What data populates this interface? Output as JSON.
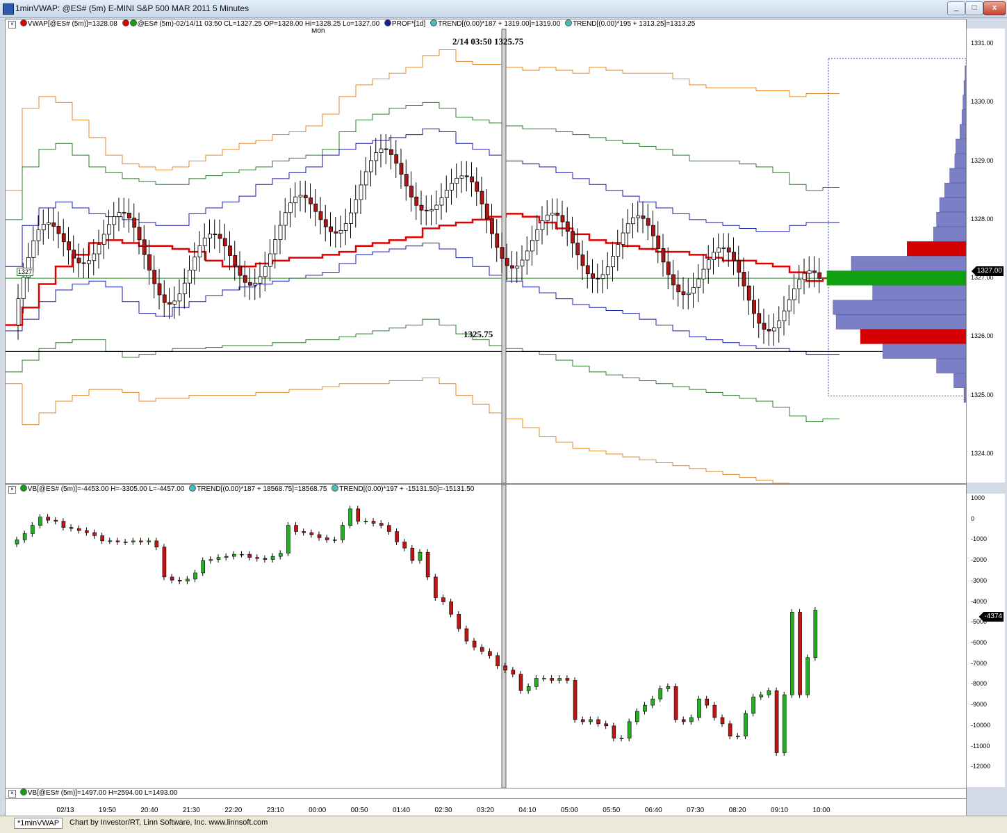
{
  "window": {
    "title": "1minVWAP: @ES# (5m) E-MINI S&P 500 MAR 2011 5 Minutes",
    "minimize": "_",
    "maximize": "□",
    "close": "x"
  },
  "price_pane": {
    "legend": {
      "close_x": "×",
      "vwap": "VWAP[@ES# (5m)]=1328.08",
      "bars": "@ES# (5m)-02/14/11 03:50 CL=1327.25 OP=1328.00 Hi=1328.25 Lo=1327.00",
      "prof": "PROF*[1d]",
      "trend1": "TREND[(0.00)*187 + 1319.00]=1319.00",
      "trend2": "TREND[(0.00)*195 + 1313.25]=1313.25"
    },
    "day_label": "Mon",
    "crosshair_label": "2/14 03:50  1325.75",
    "hline_label": "1325.75",
    "small_tag": "1327",
    "last_price_tag": "1327.00",
    "colors": {
      "vwap": "#e00000",
      "band1": "#1a1aa8",
      "band2": "#2d7a2d",
      "band3": "#e0892a",
      "up": "#ffffff",
      "down": "#b01515",
      "profile": "#7b7fc6",
      "poc": "#10a010",
      "value_edge": "#d40000"
    }
  },
  "vb_pane": {
    "legend": {
      "close_x": "×",
      "vb": "VB[@ES# (5m)]=-4453.00 H=-3305.00 L=-4457.00",
      "trend1": "TREND[(0.00)*187 + 18568.75]=18568.75",
      "trend2": "TREND[(0.00)*197 + -15131.50]=-15131.50"
    },
    "last_value_tag": "-4374"
  },
  "volume_pane": {
    "legend": {
      "close_x": "×",
      "vb": "VB[@ES# (5m)]=1497.00 H=2594.00 L=1493.00"
    }
  },
  "tabs": {
    "active": "*1minVWAP",
    "credit": "Chart by Investor/RT, Linn Software, Inc. www.linnsoft.com"
  },
  "chart_data": [
    {
      "type": "candlestick",
      "title": "1minVWAP: @ES# (5m) E-MINI S&P 500 MAR 2011 5 Minutes",
      "ylim": [
        1323.5,
        1331.25
      ],
      "y_ticks": [
        "1331.00",
        "1330.00",
        "1329.00",
        "1328.00",
        "1327.00",
        "1326.00",
        "1325.00",
        "1324.00"
      ],
      "x_ticks": [
        "02/13",
        "19:50",
        "20:40",
        "21:30",
        "22:20",
        "23:10",
        "00:00",
        "00:50",
        "01:40",
        "02:30",
        "03:20",
        "04:10",
        "05:00",
        "05:50",
        "06:40",
        "07:30",
        "08:20",
        "09:10",
        "10:00"
      ],
      "vwap": [
        1326.2,
        1326.5,
        1326.9,
        1327.2,
        1327.4,
        1327.6,
        1327.65,
        1327.6,
        1327.55,
        1327.55,
        1327.5,
        1327.45,
        1327.3,
        1327.2,
        1327.2,
        1327.25,
        1327.3,
        1327.35,
        1327.35,
        1327.4,
        1327.45,
        1327.55,
        1327.6,
        1327.65,
        1327.7,
        1327.85,
        1327.9,
        1327.95,
        1328.0,
        1328.05,
        1328.1,
        1328.05,
        1327.95,
        1327.85,
        1327.75,
        1327.65,
        1327.6,
        1327.55,
        1327.5,
        1327.45,
        1327.45,
        1327.4,
        1327.35,
        1327.3,
        1327.3,
        1327.25,
        1327.2,
        1327.1,
        1326.95,
        1327.0
      ],
      "band1_upper": [
        1327.2,
        1327.9,
        1328.2,
        1328.3,
        1328.2,
        1328.1,
        1328.05,
        1328.0,
        1327.95,
        1327.9,
        1327.9,
        1328.1,
        1328.2,
        1328.3,
        1328.4,
        1328.6,
        1328.7,
        1328.8,
        1328.9,
        1329.1,
        1329.2,
        1329.3,
        1329.35,
        1329.4,
        1329.45,
        1329.55,
        1329.5,
        1329.3,
        1329.2,
        1329.1,
        1329.0,
        1328.95,
        1328.9,
        1328.8,
        1328.7,
        1328.6,
        1328.5,
        1328.4,
        1328.3,
        1328.2,
        1328.1,
        1328.0,
        1327.95,
        1327.9,
        1327.85,
        1327.8,
        1327.8,
        1327.9,
        1327.95,
        1327.95
      ],
      "band1_lower": [
        1326.1,
        1326.3,
        1326.6,
        1326.8,
        1326.9,
        1326.95,
        1326.85,
        1326.6,
        1326.4,
        1326.35,
        1326.5,
        1326.6,
        1326.7,
        1326.8,
        1326.85,
        1326.9,
        1326.95,
        1327.0,
        1327.05,
        1327.1,
        1327.25,
        1327.4,
        1327.45,
        1327.5,
        1327.55,
        1327.6,
        1327.5,
        1327.35,
        1327.2,
        1327.05,
        1326.95,
        1326.85,
        1326.75,
        1326.65,
        1326.55,
        1326.5,
        1326.45,
        1326.4,
        1326.3,
        1326.2,
        1326.1,
        1326.0,
        1325.95,
        1325.9,
        1325.85,
        1325.8,
        1325.8,
        1325.75,
        1325.7,
        1325.7
      ],
      "band2_upper": [
        1328.0,
        1328.9,
        1329.2,
        1329.3,
        1329.1,
        1328.9,
        1328.8,
        1328.7,
        1328.65,
        1328.6,
        1328.6,
        1328.7,
        1328.75,
        1328.8,
        1328.85,
        1328.9,
        1329.0,
        1329.05,
        1329.1,
        1329.2,
        1329.5,
        1329.7,
        1329.8,
        1329.9,
        1329.95,
        1330.0,
        1329.9,
        1329.75,
        1329.7,
        1329.65,
        1329.6,
        1329.55,
        1329.55,
        1329.5,
        1329.45,
        1329.4,
        1329.35,
        1329.3,
        1329.25,
        1329.2,
        1329.1,
        1329.0,
        1329.0,
        1329.0,
        1328.95,
        1328.9,
        1328.8,
        1328.6,
        1328.5,
        1328.55
      ],
      "band2_lower": [
        1325.4,
        1325.6,
        1325.8,
        1325.9,
        1325.95,
        1325.95,
        1325.75,
        1325.65,
        1325.7,
        1325.75,
        1325.8,
        1325.8,
        1325.82,
        1325.85,
        1325.85,
        1325.85,
        1325.9,
        1325.9,
        1325.95,
        1325.95,
        1326.0,
        1326.05,
        1326.1,
        1326.15,
        1326.2,
        1326.3,
        1326.2,
        1326.05,
        1325.95,
        1325.85,
        1325.8,
        1325.75,
        1325.7,
        1325.6,
        1325.5,
        1325.4,
        1325.35,
        1325.3,
        1325.25,
        1325.2,
        1325.15,
        1325.1,
        1325.05,
        1325.0,
        1324.95,
        1324.9,
        1324.8,
        1324.65,
        1324.55,
        1324.6
      ],
      "band3_upper": [
        1328.5,
        1329.9,
        1330.1,
        1330.0,
        1329.7,
        1329.4,
        1329.1,
        1328.95,
        1328.9,
        1328.85,
        1328.9,
        1329.0,
        1329.1,
        1329.2,
        1329.3,
        1329.35,
        1329.45,
        1329.5,
        1329.6,
        1329.8,
        1330.1,
        1330.3,
        1330.4,
        1330.5,
        1330.6,
        1330.8,
        1330.9,
        1330.7,
        1330.65,
        1330.65,
        1330.6,
        1330.55,
        1330.6,
        1330.55,
        1330.5,
        1330.6,
        1330.55,
        1330.5,
        1330.5,
        1330.5,
        1330.4,
        1330.3,
        1330.25,
        1330.25,
        1330.25,
        1330.2,
        1330.2,
        1330.1,
        1330.15,
        1330.15
      ],
      "band3_lower": [
        1325.2,
        1324.5,
        1324.7,
        1324.9,
        1325.0,
        1325.1,
        1325.1,
        1325.05,
        1324.9,
        1324.95,
        1324.95,
        1325.0,
        1325.0,
        1325.0,
        1325.0,
        1325.05,
        1325.05,
        1325.1,
        1325.1,
        1325.15,
        1325.2,
        1325.2,
        1325.2,
        1325.25,
        1325.25,
        1325.3,
        1325.2,
        1325.0,
        1324.85,
        1324.7,
        1324.6,
        1324.45,
        1324.3,
        1324.2,
        1324.1,
        1324.05,
        1324.0,
        1323.95,
        1323.9,
        1323.85,
        1323.8,
        1323.75,
        1323.7,
        1323.65,
        1323.6,
        1323.55,
        1323.5,
        1323.4,
        1323.35,
        1323.4
      ],
      "profile": [
        {
          "price": 1330.5,
          "volume": 1
        },
        {
          "price": 1330.25,
          "volume": 2
        },
        {
          "price": 1330.0,
          "volume": 3
        },
        {
          "price": 1329.75,
          "volume": 4
        },
        {
          "price": 1329.5,
          "volume": 6
        },
        {
          "price": 1329.25,
          "volume": 10
        },
        {
          "price": 1329.0,
          "volume": 11
        },
        {
          "price": 1328.75,
          "volume": 16
        },
        {
          "price": 1328.5,
          "volume": 21
        },
        {
          "price": 1328.25,
          "volume": 26
        },
        {
          "price": 1328.0,
          "volume": 29
        },
        {
          "price": 1327.75,
          "volume": 32
        },
        {
          "price": 1327.5,
          "volume": 58
        },
        {
          "price": 1327.25,
          "volume": 113
        },
        {
          "price": 1327.0,
          "volume": 137
        },
        {
          "price": 1326.75,
          "volume": 92
        },
        {
          "price": 1326.5,
          "volume": 131
        },
        {
          "price": 1326.25,
          "volume": 128
        },
        {
          "price": 1326.0,
          "volume": 104
        },
        {
          "price": 1325.75,
          "volume": 82
        },
        {
          "price": 1325.5,
          "volume": 29
        },
        {
          "price": 1325.25,
          "volume": 12
        },
        {
          "price": 1325.0,
          "volume": 2
        }
      ],
      "poc": 1327.0,
      "value_area_high": 1327.5,
      "value_area_low": 1326.0
    },
    {
      "type": "candlestick",
      "title": "VB[@ES# (5m)]",
      "ylim": [
        -13000,
        1200
      ],
      "y_ticks": [
        "1000",
        "0",
        "-1000",
        "-2000",
        "-3000",
        "-4000",
        "-5000",
        "-6000",
        "-7000",
        "-8000",
        "-9000",
        "-10000",
        "-11000",
        "-12000"
      ],
      "close": [
        -1000,
        -700,
        -300,
        100,
        -50,
        -100,
        -400,
        -450,
        -550,
        -650,
        -800,
        -1050,
        -1050,
        -1100,
        -1100,
        -1050,
        -1100,
        -1050,
        -1350,
        -2800,
        -2950,
        -3000,
        -2900,
        -2600,
        -2000,
        -1950,
        -1850,
        -1800,
        -1700,
        -1700,
        -1850,
        -1900,
        -1950,
        -1800,
        -1650,
        -300,
        -600,
        -650,
        -750,
        -900,
        -1000,
        -1000,
        -300,
        500,
        -100,
        -100,
        -200,
        -300,
        -600,
        -1100,
        -1400,
        -2000,
        -1600,
        -2800,
        -3800,
        -4000,
        -4600,
        -5300,
        -5900,
        -6200,
        -6400,
        -6600,
        -7100,
        -7300,
        -7500,
        -8300,
        -8100,
        -7700,
        -7700,
        -7800,
        -7700,
        -7800,
        -9700,
        -9800,
        -9700,
        -9900,
        -10000,
        -10600,
        -10600,
        -9800,
        -9300,
        -9000,
        -8700,
        -8200,
        -8100,
        -9700,
        -9800,
        -9600,
        -8700,
        -9000,
        -9600,
        -9900,
        -10500,
        -10500,
        -9400,
        -8600,
        -8500,
        -8300,
        -11300,
        -8500,
        -4500,
        -8500,
        -6700,
        -4400
      ]
    }
  ]
}
